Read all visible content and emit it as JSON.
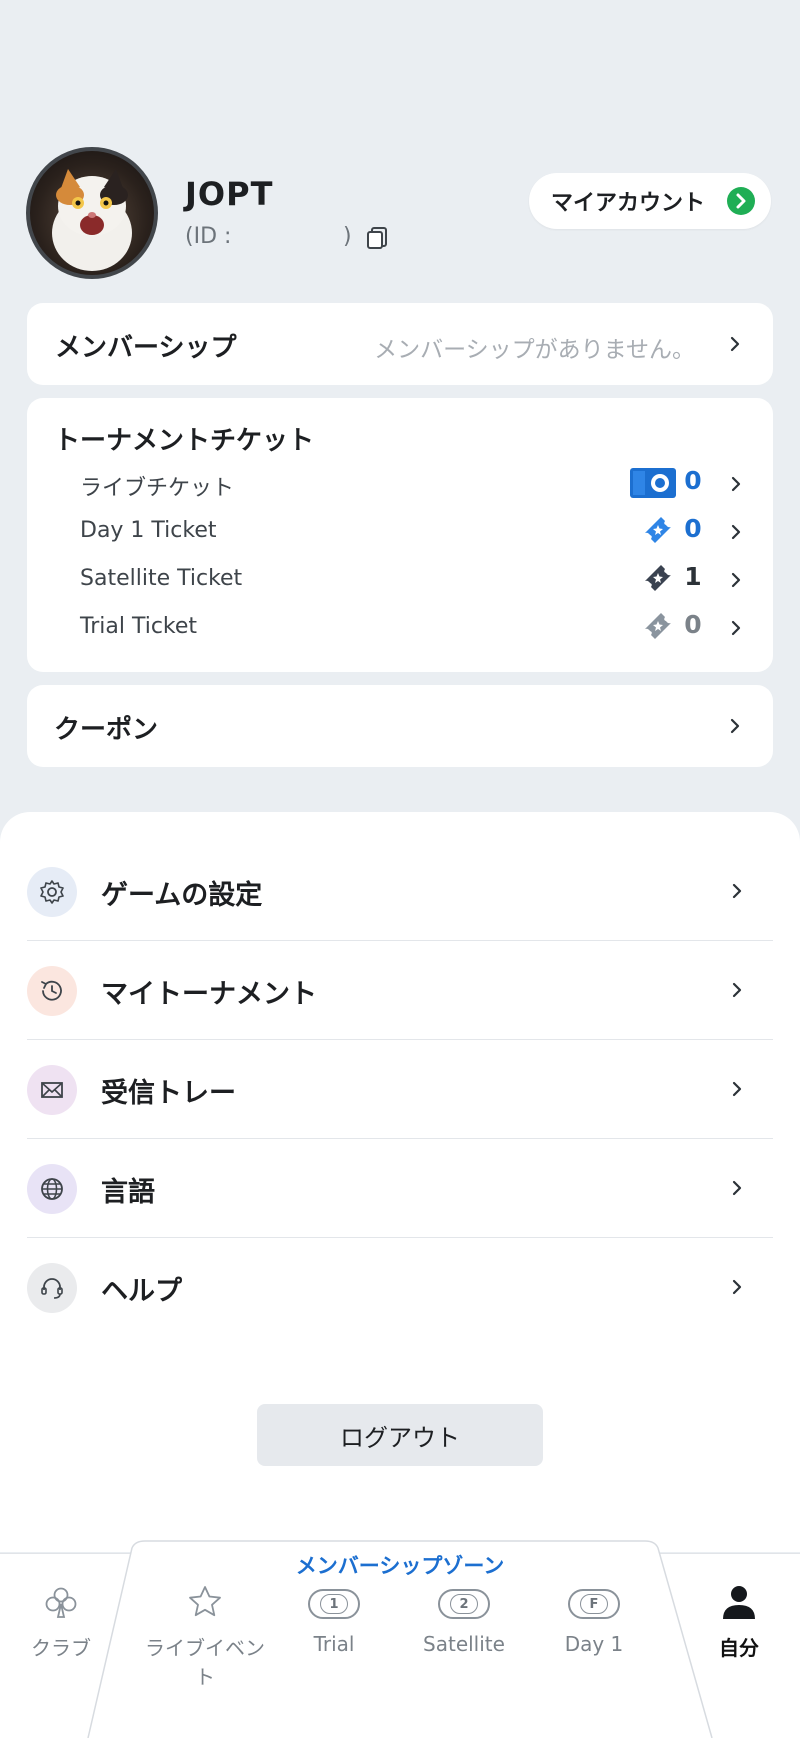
{
  "profile": {
    "name": "JOPT",
    "id_prefix": "(ID :",
    "id_suffix": ")",
    "my_account_label": "マイアカウント"
  },
  "membership": {
    "label": "メンバーシップ",
    "status": "メンバーシップがありません。"
  },
  "tickets": {
    "title": "トーナメントチケット",
    "items": [
      {
        "label": "ライブチケット",
        "count": "0",
        "count_color": "#1c6fd0"
      },
      {
        "label": "Day 1 Ticket",
        "count": "0",
        "count_color": "#1c6fd0"
      },
      {
        "label": "Satellite Ticket",
        "count": "1",
        "count_color": "#2c3238"
      },
      {
        "label": "Trial Ticket",
        "count": "0",
        "count_color": "#7b8289"
      }
    ]
  },
  "coupon": {
    "label": "クーポン"
  },
  "menu": [
    {
      "label": "ゲームの設定",
      "icon": "gear-icon"
    },
    {
      "label": "マイトーナメント",
      "icon": "history-icon"
    },
    {
      "label": "受信トレー",
      "icon": "mail-icon"
    },
    {
      "label": "言語",
      "icon": "globe-icon"
    },
    {
      "label": "ヘルプ",
      "icon": "headset-icon"
    }
  ],
  "logout_label": "ログアウト",
  "tabbar": {
    "zone_title": "メンバーシップゾーン",
    "tabs": [
      {
        "label": "クラブ",
        "icon": "club-icon"
      },
      {
        "label": "ライブイベント",
        "icon": "star-icon"
      },
      {
        "label": "Trial",
        "icon": "trial-badge-icon",
        "badge": "1"
      },
      {
        "label": "Satellite",
        "icon": "satellite-badge-icon",
        "badge": "2"
      },
      {
        "label": "Day 1",
        "icon": "day1-badge-icon",
        "badge": "F"
      },
      {
        "label": "自分",
        "icon": "person-icon",
        "active": true
      }
    ]
  },
  "colors": {
    "background": "#eaeef2",
    "accent_blue": "#1c6fd0",
    "go_green": "#1fae55"
  }
}
